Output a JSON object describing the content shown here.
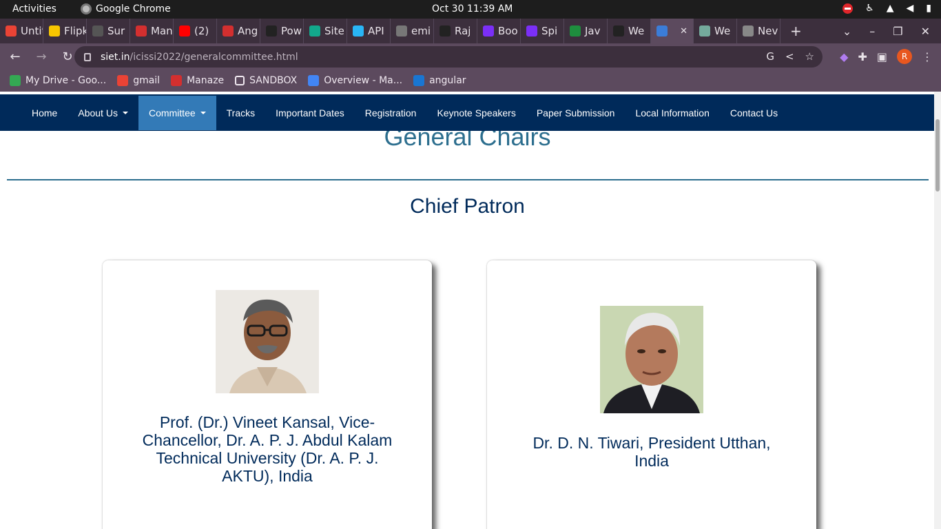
{
  "os": {
    "activities": "Activities",
    "app_name": "Google Chrome",
    "clock": "Oct 30  11:39 AM"
  },
  "tabs": [
    {
      "label": "Untitled",
      "icon": "gmail-icon",
      "color": "#ea4335"
    },
    {
      "label": "Flipkart",
      "icon": "flipkart-icon",
      "color": "#f7c600"
    },
    {
      "label": "Sur",
      "icon": "grid-icon",
      "color": "#555555"
    },
    {
      "label": "Manaze",
      "icon": "umbrella-icon",
      "color": "#d32f2f"
    },
    {
      "label": "(2)",
      "icon": "youtube-icon",
      "color": "#ff0000"
    },
    {
      "label": "Ang",
      "icon": "b-icon",
      "color": "#d32f2f"
    },
    {
      "label": "Pow",
      "icon": "terminal-icon",
      "color": "#222222"
    },
    {
      "label": "Site",
      "icon": "diamond-icon",
      "color": "#12a88c"
    },
    {
      "label": "API",
      "icon": "snowflake-icon",
      "color": "#29b6f6"
    },
    {
      "label": "emi",
      "icon": "ring-icon",
      "color": "#777777"
    },
    {
      "label": "Raj",
      "icon": "angular-icon",
      "color": "#222222"
    },
    {
      "label": "Boo",
      "icon": "bootstrap-icon",
      "color": "#7b2ff7"
    },
    {
      "label": "Spi",
      "icon": "bootstrap-icon",
      "color": "#7b2ff7"
    },
    {
      "label": "Jav",
      "icon": "w-icon",
      "color": "#1e8e3e"
    },
    {
      "label": "We",
      "icon": "github-icon",
      "color": "#222222"
    },
    {
      "label": "",
      "icon": "active-tab-icon",
      "color": "#3b7dd8",
      "active": true
    },
    {
      "label": "We",
      "icon": "openai-icon",
      "color": "#74aa9c"
    },
    {
      "label": "Nev",
      "icon": "chrome-icon",
      "color": "#888888"
    }
  ],
  "address": {
    "host": "siet.in",
    "path": "/icissi2022/generalcommittee.html"
  },
  "bookmarks": [
    {
      "label": "My Drive - Goo...",
      "icon": "drive-icon",
      "color": "#34a853"
    },
    {
      "label": "gmail",
      "icon": "gmail-icon",
      "color": "#ea4335"
    },
    {
      "label": "Manaze",
      "icon": "umbrella-icon",
      "color": "#d32f2f"
    },
    {
      "label": "SANDBOX",
      "icon": "folder-outline-icon",
      "color": "#5c4a5e"
    },
    {
      "label": "Overview - Ma...",
      "icon": "overview-icon",
      "color": "#4285f4"
    },
    {
      "label": "angular",
      "icon": "angular-shield-icon",
      "color": "#1976d2"
    }
  ],
  "site_nav": [
    {
      "label": "Home"
    },
    {
      "label": "About Us",
      "dropdown": true
    },
    {
      "label": "Committee",
      "dropdown": true,
      "active": true
    },
    {
      "label": "Tracks"
    },
    {
      "label": "Important Dates"
    },
    {
      "label": "Registration"
    },
    {
      "label": "Keynote Speakers"
    },
    {
      "label": "Paper Submission"
    },
    {
      "label": "Local Information"
    },
    {
      "label": "Contact Us"
    }
  ],
  "page": {
    "section_heading": "General Chairs",
    "subheading": "Chief Patron"
  },
  "patrons": [
    {
      "name": "Prof. (Dr.) Vineet Kansal, Vice-Chancellor, Dr. A. P. J. Abdul Kalam Technical University (Dr. A. P. J. AKTU), India"
    },
    {
      "name": "Dr. D. N. Tiwari, President Utthan, India"
    }
  ]
}
